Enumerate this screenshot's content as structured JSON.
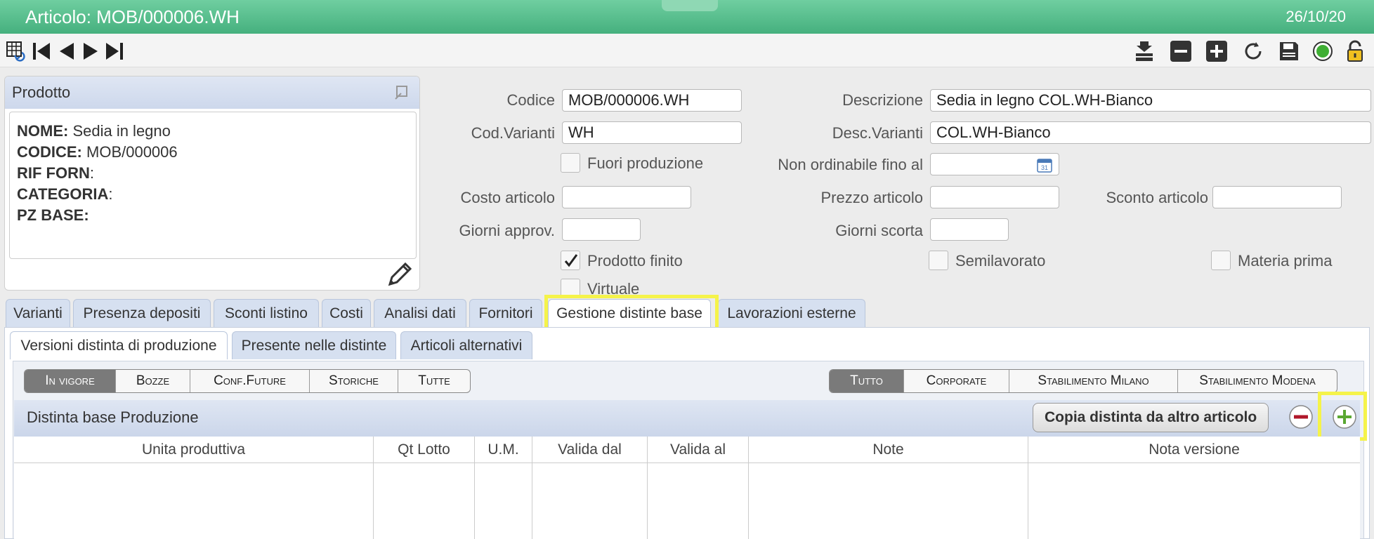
{
  "window": {
    "title": "Articolo: MOB/000006.WH",
    "date": "26/10/20"
  },
  "toolbar": {
    "left_icons": [
      "grid-back-icon",
      "first-record-icon",
      "prev-record-icon",
      "next-record-icon",
      "last-record-icon"
    ],
    "right_icons": [
      "stack-icon",
      "minus-icon",
      "plus-icon",
      "refresh-icon",
      "save-icon",
      "status-circle-icon",
      "unlock-icon"
    ]
  },
  "product": {
    "header": "Prodotto",
    "lines": [
      {
        "key": "NOME:",
        "value": " Sedia in legno"
      },
      {
        "key": "CODICE:",
        "value": " MOB/000006"
      },
      {
        "key": "RIF FORN",
        "value": ":"
      },
      {
        "key": "CATEGORIA",
        "value": ":"
      },
      {
        "key": "PZ BASE:",
        "value": ""
      }
    ]
  },
  "form": {
    "codice": {
      "label": "Codice",
      "value": "MOB/000006.WH"
    },
    "descrizione": {
      "label": "Descrizione",
      "value": "Sedia in legno COL.WH-Bianco"
    },
    "cod_varianti": {
      "label": "Cod.Varianti",
      "value": "WH"
    },
    "desc_varianti": {
      "label": "Desc.Varianti",
      "value": "COL.WH-Bianco"
    },
    "fuori_produzione": {
      "label": "Fuori produzione",
      "checked": false
    },
    "non_ordinabile": {
      "label": "Non ordinabile fino al",
      "value": ""
    },
    "costo": {
      "label": "Costo articolo",
      "value": ""
    },
    "prezzo": {
      "label": "Prezzo articolo",
      "value": ""
    },
    "sconto": {
      "label": "Sconto articolo",
      "value": ""
    },
    "giorni_approv": {
      "label": "Giorni approv.",
      "value": ""
    },
    "giorni_scorta": {
      "label": "Giorni scorta",
      "value": ""
    },
    "prodotto_finito": {
      "label": "Prodotto finito",
      "checked": true
    },
    "semilavorato": {
      "label": "Semilavorato",
      "checked": false
    },
    "materia_prima": {
      "label": "Materia prima",
      "checked": false
    },
    "virtuale": {
      "label": "Virtuale",
      "checked": false
    }
  },
  "tabs": [
    "Varianti",
    "Presenza depositi",
    "Sconti listino",
    "Costi",
    "Analisi dati",
    "Fornitori",
    "Gestione distinte base",
    "Lavorazioni esterne"
  ],
  "active_tab": "Gestione distinte base",
  "subtabs": [
    "Versioni distinta di produzione",
    "Presente nelle distinte",
    "Articoli alternativi"
  ],
  "active_subtab": "Versioni distinta di produzione",
  "filter_state": {
    "options": [
      "In vigore",
      "Bozze",
      "Conf.Future",
      "Storiche",
      "Tutte"
    ],
    "selected": "In vigore"
  },
  "filter_site": {
    "options": [
      "Tutto",
      "Corporate",
      "Stabilimento Milano",
      "Stabilimento Modena"
    ],
    "selected": "Tutto"
  },
  "distinta": {
    "title": "Distinta base Produzione",
    "copy_button": "Copia distinta da altro articolo",
    "columns": [
      "Unita produttiva",
      "Qt Lotto",
      "U.M.",
      "Valida dal",
      "Valida al",
      "Note",
      "Nota versione"
    ],
    "rows": []
  },
  "colors": {
    "titlebar": "#45b07e",
    "tab": "#d6e0f0",
    "highlight": "#f5f34a",
    "add": "#5aa832",
    "remove": "#b0182a"
  }
}
